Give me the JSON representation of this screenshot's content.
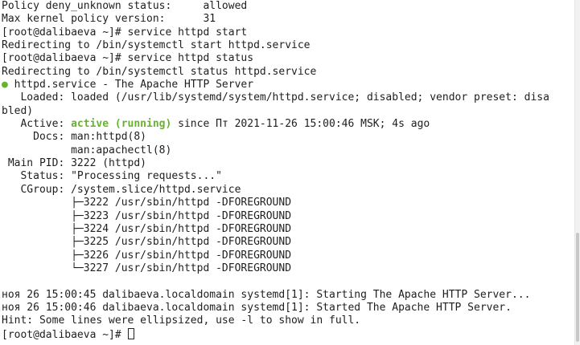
{
  "terminal": {
    "lines": {
      "l1": "Policy deny_unknown status:     allowed",
      "l2": "Max kernel policy version:      31",
      "l3": "[root@dalibaeva ~]# service httpd start",
      "l4": "Redirecting to /bin/systemctl start httpd.service",
      "l5": "[root@dalibaeva ~]# service httpd status",
      "l6": "Redirecting to /bin/systemctl status httpd.service",
      "l7_dot": "●",
      "l7_text": " httpd.service - The Apache HTTP Server",
      "l8": "   Loaded: loaded (/usr/lib/systemd/system/httpd.service; disabled; vendor preset: disa",
      "l9": "bled)",
      "l10_pre": "   Active: ",
      "l10_status": "active (running)",
      "l10_post": " since Пт 2021-11-26 15:00:46 MSK; 4s ago",
      "l11": "     Docs: man:httpd(8)",
      "l12": "           man:apachectl(8)",
      "l13": " Main PID: 3222 (httpd)",
      "l14": "   Status: \"Processing requests...\"",
      "l15": "   CGroup: /system.slice/httpd.service",
      "l16": "           ├─3222 /usr/sbin/httpd -DFOREGROUND",
      "l17": "           ├─3223 /usr/sbin/httpd -DFOREGROUND",
      "l18": "           ├─3224 /usr/sbin/httpd -DFOREGROUND",
      "l19": "           ├─3225 /usr/sbin/httpd -DFOREGROUND",
      "l20": "           ├─3226 /usr/sbin/httpd -DFOREGROUND",
      "l21": "           └─3227 /usr/sbin/httpd -DFOREGROUND",
      "l23": "ноя 26 15:00:45 dalibaeva.localdomain systemd[1]: Starting The Apache HTTP Server...",
      "l24": "ноя 26 15:00:46 dalibaeva.localdomain systemd[1]: Started The Apache HTTP Server.",
      "l25": "Hint: Some lines were ellipsized, use -l to show in full.",
      "l26": "[root@dalibaeva ~]# "
    }
  },
  "colors": {
    "background": "#ffffff",
    "text": "#1e1e1e",
    "active_green": "#66b32e"
  },
  "icons": {
    "status_dot": "green-dot-icon",
    "cursor": "block-cursor-icon"
  }
}
